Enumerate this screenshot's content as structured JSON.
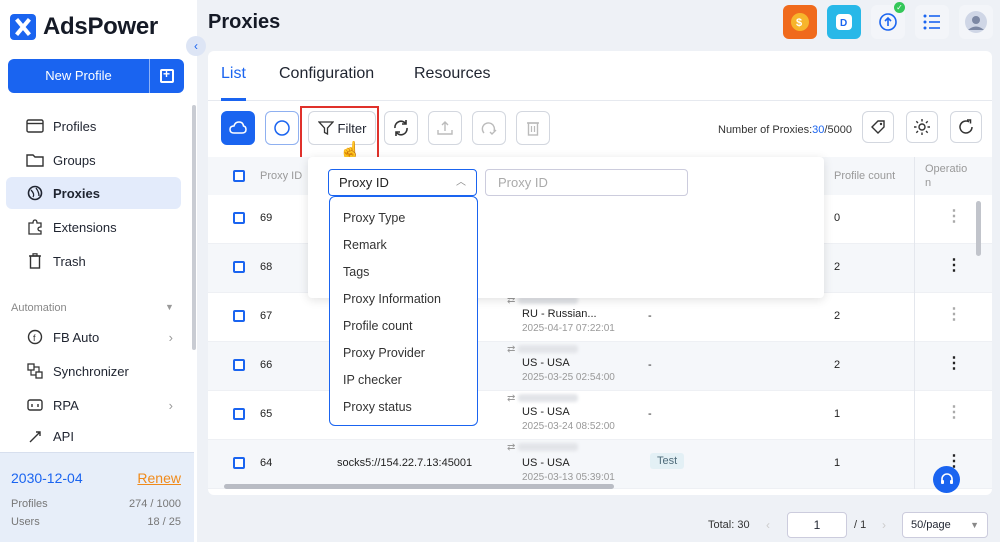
{
  "app": {
    "brand": "AdsPower",
    "page_title": "Proxies"
  },
  "sidebar": {
    "new_profile_label": "New Profile",
    "nav": [
      {
        "label": "Profiles",
        "icon": "profiles-icon"
      },
      {
        "label": "Groups",
        "icon": "folder-icon"
      },
      {
        "label": "Proxies",
        "icon": "proxies-icon"
      },
      {
        "label": "Extensions",
        "icon": "puzzle-icon"
      },
      {
        "label": "Trash",
        "icon": "trash-icon"
      }
    ],
    "automation_label": "Automation",
    "automation": [
      {
        "label": "FB Auto",
        "icon": "facebook-icon"
      },
      {
        "label": "Synchronizer",
        "icon": "sync-icon"
      },
      {
        "label": "RPA",
        "icon": "rpa-icon"
      },
      {
        "label": "API",
        "icon": "api-icon"
      }
    ],
    "plan": {
      "expiry": "2030-12-04",
      "renew_label": "Renew",
      "profiles_label": "Profiles",
      "profiles_value": "274 / 1000",
      "users_label": "Users",
      "users_value": "18 / 25"
    }
  },
  "tabs": [
    "List",
    "Configuration",
    "Resources"
  ],
  "toolbar": {
    "filter_label": "Filter",
    "proxy_count_label": "Number of Proxies:",
    "proxy_count_used": "30",
    "proxy_count_total": "/5000"
  },
  "table": {
    "headers": {
      "id": "Proxy ID",
      "profile_count": "Profile count",
      "operation": "Operatio n"
    },
    "rows": [
      {
        "id": "69",
        "proxy": "",
        "location": "",
        "date": "",
        "remark": "",
        "tag": "",
        "profile_count": "0"
      },
      {
        "id": "68",
        "proxy": "",
        "location": "",
        "date": "",
        "remark": "",
        "tag": "",
        "profile_count": "2"
      },
      {
        "id": "67",
        "proxy": "",
        "location": "RU - Russian...",
        "date": "2025-04-17 07:22:01",
        "remark": "-",
        "tag": "",
        "profile_count": "2"
      },
      {
        "id": "66",
        "proxy": "",
        "location": "US - USA",
        "date": "2025-03-25 02:54:00",
        "remark": "-",
        "tag": "",
        "profile_count": "2"
      },
      {
        "id": "65",
        "proxy": "",
        "location": "US - USA",
        "date": "2025-03-24 08:52:00",
        "remark": "-",
        "tag": "",
        "profile_count": "1"
      },
      {
        "id": "64",
        "proxy": "socks5://154.22.7.13:45001",
        "location": "US - USA",
        "date": "2025-03-13 05:39:01",
        "remark": "",
        "tag": "Test",
        "profile_count": "1"
      }
    ]
  },
  "filter_panel": {
    "field_select": "Proxy ID",
    "value_placeholder": "Proxy ID",
    "options": [
      "Proxy Type",
      "Remark",
      "Tags",
      "Proxy Information",
      "Profile count",
      "Proxy Provider",
      "IP checker",
      "Proxy status"
    ]
  },
  "footer": {
    "total": "Total: 30",
    "current_page": "1",
    "of_pages": "/ 1",
    "page_size": "50/page"
  },
  "colors": {
    "accent": "#1a64f0",
    "highlight_box": "#e0312b",
    "renew": "#f08a1a"
  }
}
